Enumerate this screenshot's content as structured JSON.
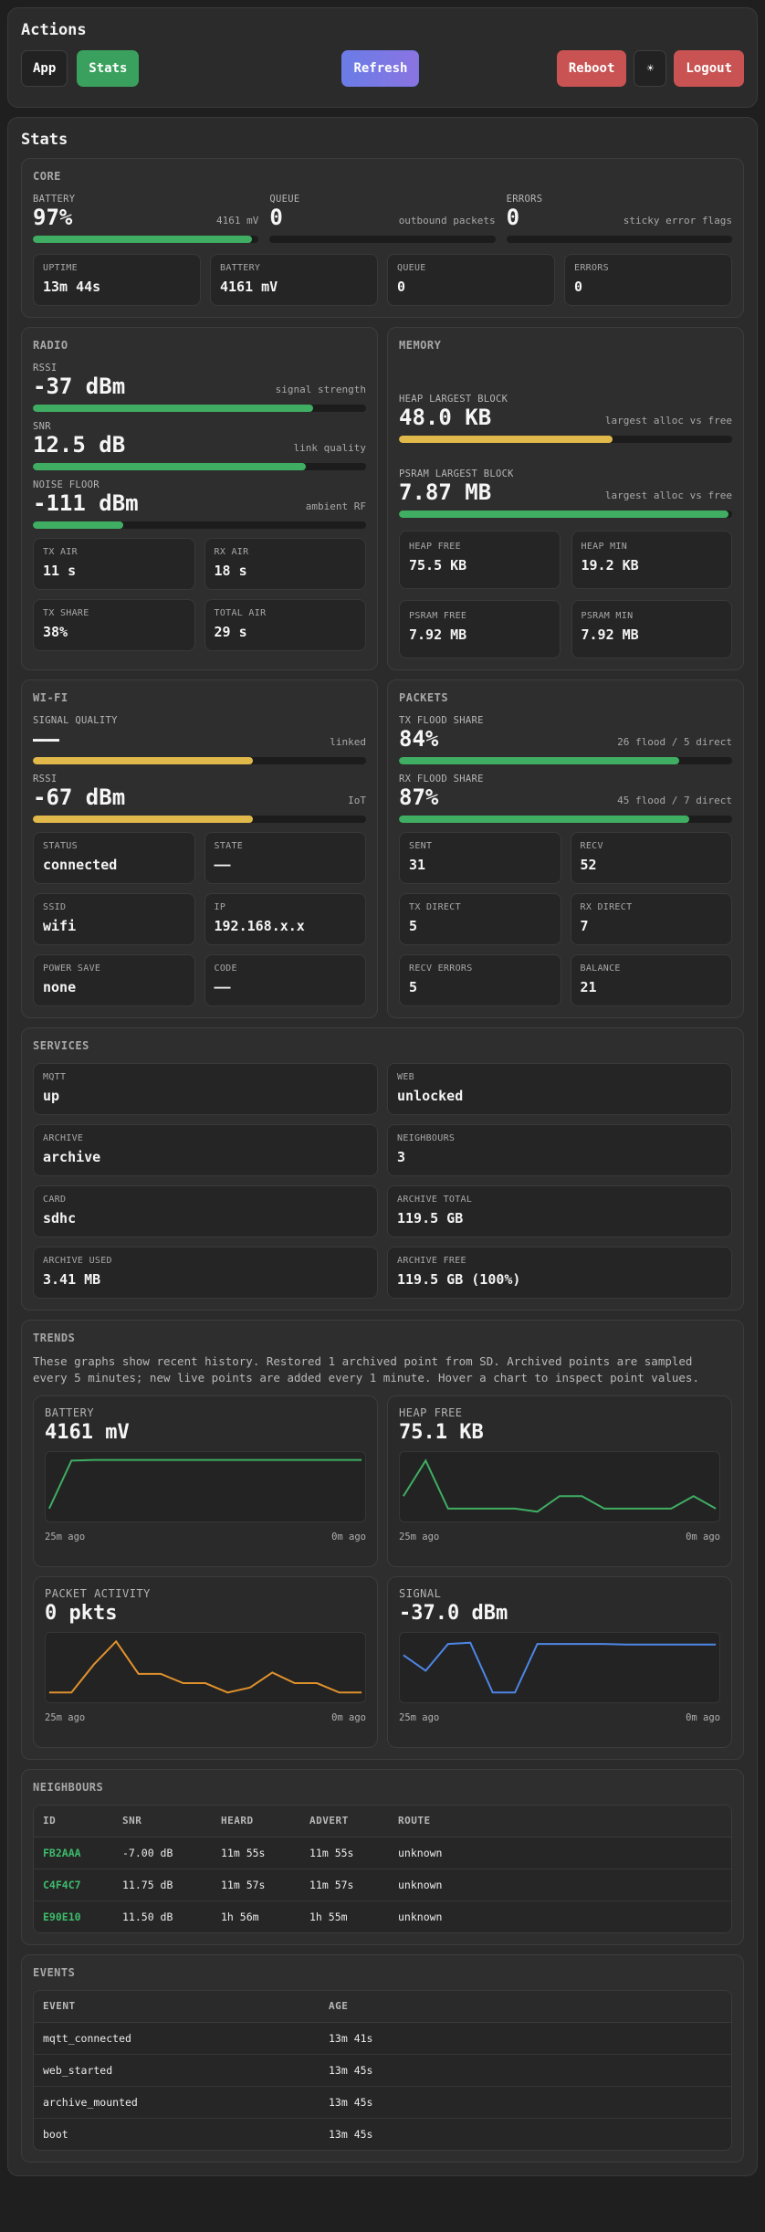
{
  "actions": {
    "title": "Actions",
    "app_label": "App",
    "stats_label": "Stats",
    "refresh_label": "Refresh",
    "reboot_label": "Reboot",
    "theme_icon": "☀",
    "logout_label": "Logout"
  },
  "stats": {
    "title": "Stats",
    "core": {
      "title": "CORE",
      "battery": {
        "label": "BATTERY",
        "value": "97%",
        "note": "4161 mV",
        "fill": 0.97,
        "color": "#3fae63"
      },
      "queue": {
        "label": "QUEUE",
        "value": "0",
        "note": "outbound packets",
        "fill": 0.0
      },
      "errors": {
        "label": "ERRORS",
        "value": "0",
        "note": "sticky error flags",
        "fill": 0.0
      },
      "tiles": [
        {
          "label": "UPTIME",
          "value": "13m 44s"
        },
        {
          "label": "BATTERY",
          "value": "4161 mV"
        },
        {
          "label": "QUEUE",
          "value": "0"
        },
        {
          "label": "ERRORS",
          "value": "0"
        }
      ]
    },
    "radio": {
      "title": "RADIO",
      "rssi": {
        "label": "RSSI",
        "value": "-37 dBm",
        "note": "signal strength",
        "fill": 0.84,
        "color": "#3fae63"
      },
      "snr": {
        "label": "SNR",
        "value": "12.5 dB",
        "note": "link quality",
        "fill": 0.82,
        "color": "#3fae63"
      },
      "noise": {
        "label": "NOISE FLOOR",
        "value": "-111 dBm",
        "note": "ambient RF",
        "fill": 0.27,
        "color": "#3fae63"
      },
      "tiles": [
        {
          "label": "TX AIR",
          "value": "11 s"
        },
        {
          "label": "RX AIR",
          "value": "18 s"
        },
        {
          "label": "TX SHARE",
          "value": "38%"
        },
        {
          "label": "TOTAL AIR",
          "value": "29 s"
        }
      ]
    },
    "memory": {
      "title": "MEMORY",
      "heap_largest": {
        "label": "HEAP LARGEST BLOCK",
        "value": "48.0 KB",
        "note": "largest alloc vs free",
        "fill": 0.64,
        "color": "#e1b84a"
      },
      "psram_largest": {
        "label": "PSRAM LARGEST BLOCK",
        "value": "7.87 MB",
        "note": "largest alloc vs free",
        "fill": 0.99,
        "color": "#3fae63"
      },
      "tiles": [
        {
          "label": "HEAP FREE",
          "value": "75.5 KB"
        },
        {
          "label": "HEAP MIN",
          "value": "19.2 KB"
        },
        {
          "label": "PSRAM FREE",
          "value": "7.92 MB"
        },
        {
          "label": "PSRAM MIN",
          "value": "7.92 MB"
        }
      ]
    },
    "wifi": {
      "title": "WI-FI",
      "signal": {
        "label": "SIGNAL QUALITY",
        "value": "——",
        "note": "linked",
        "fill": 0.66,
        "color": "#e1b84a"
      },
      "rssi": {
        "label": "RSSI",
        "value": "-67 dBm",
        "note": "IoT",
        "fill": 0.66,
        "color": "#e1b84a"
      },
      "tiles": [
        {
          "label": "STATUS",
          "value": "connected"
        },
        {
          "label": "STATE",
          "value": "——"
        },
        {
          "label": "SSID",
          "value": "wifi"
        },
        {
          "label": "IP",
          "value": "192.168.x.x"
        },
        {
          "label": "POWER SAVE",
          "value": "none"
        },
        {
          "label": "CODE",
          "value": "——"
        }
      ]
    },
    "packets": {
      "title": "PACKETS",
      "tx": {
        "label": "TX FLOOD SHARE",
        "value": "84%",
        "note": "26 flood / 5 direct",
        "fill": 0.84,
        "color": "#3fae63"
      },
      "rx": {
        "label": "RX FLOOD SHARE",
        "value": "87%",
        "note": "45 flood / 7 direct",
        "fill": 0.87,
        "color": "#3fae63"
      },
      "tiles": [
        {
          "label": "SENT",
          "value": "31"
        },
        {
          "label": "RECV",
          "value": "52"
        },
        {
          "label": "TX DIRECT",
          "value": "5"
        },
        {
          "label": "RX DIRECT",
          "value": "7"
        },
        {
          "label": "RECV ERRORS",
          "value": "5"
        },
        {
          "label": "BALANCE",
          "value": "21"
        }
      ]
    },
    "services": {
      "title": "SERVICES",
      "tiles": [
        {
          "label": "MQTT",
          "value": "up"
        },
        {
          "label": "WEB",
          "value": "unlocked"
        },
        {
          "label": "ARCHIVE",
          "value": "archive"
        },
        {
          "label": "NEIGHBOURS",
          "value": "3"
        },
        {
          "label": "CARD",
          "value": "sdhc"
        },
        {
          "label": "ARCHIVE TOTAL",
          "value": "119.5 GB"
        },
        {
          "label": "ARCHIVE USED",
          "value": "3.41 MB"
        },
        {
          "label": "ARCHIVE FREE",
          "value": "119.5 GB (100%)"
        }
      ]
    },
    "trends": {
      "title": "TRENDS",
      "description": "These graphs show recent history. Restored 1 archived point from SD. Archived points are sampled every 5 minutes; new live points are added every 1 minute. Hover a chart to inspect point values.",
      "charts": [
        {
          "label": "BATTERY",
          "value": "4161 mV",
          "start": "25m ago",
          "end": "0m ago",
          "color": "#3fae63",
          "values": [
            0.15,
            0.92,
            0.93,
            0.93,
            0.93,
            0.93,
            0.93,
            0.93,
            0.93,
            0.93,
            0.93,
            0.93,
            0.93,
            0.93,
            0.93
          ]
        },
        {
          "label": "HEAP FREE",
          "value": "75.1 KB",
          "start": "25m ago",
          "end": "0m ago",
          "color": "#3fae63",
          "values": [
            0.35,
            0.92,
            0.15,
            0.15,
            0.15,
            0.15,
            0.1,
            0.35,
            0.35,
            0.15,
            0.15,
            0.15,
            0.15,
            0.35,
            0.15
          ]
        },
        {
          "label": "PACKET ACTIVITY",
          "value": "0 pkts",
          "start": "25m ago",
          "end": "0m ago",
          "color": "#e0912c",
          "values": [
            0.1,
            0.1,
            0.55,
            0.92,
            0.4,
            0.4,
            0.25,
            0.25,
            0.1,
            0.18,
            0.42,
            0.25,
            0.25,
            0.1,
            0.1
          ]
        },
        {
          "label": "SIGNAL",
          "value": "-37.0 dBm",
          "start": "25m ago",
          "end": "0m ago",
          "color": "#4d86e6",
          "values": [
            0.7,
            0.45,
            0.88,
            0.9,
            0.1,
            0.1,
            0.88,
            0.88,
            0.88,
            0.88,
            0.87,
            0.87,
            0.87,
            0.87,
            0.87
          ]
        }
      ]
    },
    "neighbours": {
      "title": "NEIGHBOURS",
      "columns": [
        "ID",
        "SNR",
        "HEARD",
        "ADVERT",
        "ROUTE"
      ],
      "rows": [
        [
          "FB2AAA",
          "-7.00 dB",
          "11m 55s",
          "11m 55s",
          "unknown"
        ],
        [
          "C4F4C7",
          "11.75 dB",
          "11m 57s",
          "11m 57s",
          "unknown"
        ],
        [
          "E90E10",
          "11.50 dB",
          "1h 56m",
          "1h 55m",
          "unknown"
        ]
      ]
    },
    "events": {
      "title": "EVENTS",
      "columns": [
        "EVENT",
        "AGE"
      ],
      "rows": [
        [
          "mqtt_connected",
          "13m 41s"
        ],
        [
          "web_started",
          "13m 45s"
        ],
        [
          "archive_mounted",
          "13m 45s"
        ],
        [
          "boot",
          "13m 45s"
        ]
      ]
    }
  }
}
